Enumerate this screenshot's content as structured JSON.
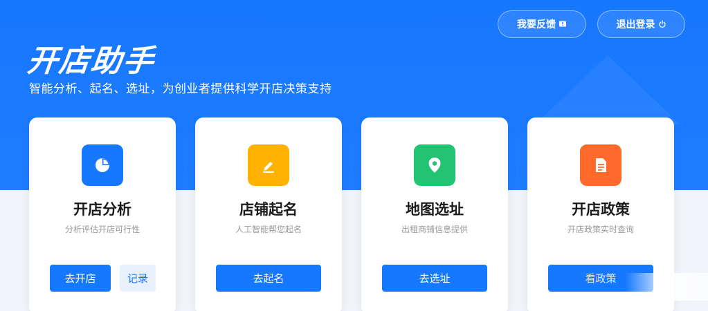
{
  "header": {
    "title": "开店助手",
    "subtitle": "智能分析、起名、选址，为创业者提供科学开店决策支持",
    "feedback_label": "我要反馈",
    "logout_label": "退出登录"
  },
  "cards": [
    {
      "title": "开店分析",
      "description": "分析评估开店可行性",
      "icon": "pie-chart-icon",
      "icon_color": "#1677ff",
      "primary_label": "去开店",
      "secondary_label": "记录"
    },
    {
      "title": "店铺起名",
      "description": "人工智能帮您起名",
      "icon": "pencil-icon",
      "icon_color": "#ffb300",
      "primary_label": "去起名"
    },
    {
      "title": "地图选址",
      "description": "出租商铺信息提供",
      "icon": "location-pin-icon",
      "icon_color": "#22c474",
      "primary_label": "去选址"
    },
    {
      "title": "开店政策",
      "description": "开店政策实时查询",
      "icon": "document-icon",
      "icon_color": "#ff6a2a",
      "primary_label": "看政策"
    }
  ],
  "colors": {
    "primary": "#1677ff",
    "background": "#f1f4f9"
  }
}
